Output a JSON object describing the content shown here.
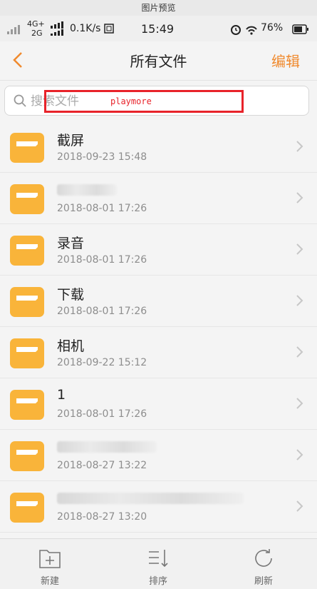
{
  "viewer_title": "图片预览",
  "status": {
    "network_top": "4G+",
    "network_bottom": "2G",
    "speed": "0.1K/s",
    "time": "15:49",
    "battery": "76%"
  },
  "nav": {
    "title": "所有文件",
    "edit": "编辑"
  },
  "search": {
    "placeholder": "搜索文件",
    "value": ""
  },
  "overlay_label": "playmore",
  "colors": {
    "accent": "#f08a2e",
    "folder": "#f9b43a",
    "overlay": "#e8232a"
  },
  "files": [
    {
      "name": "截屏",
      "date": "2018-09-23 15:48"
    },
    {
      "name": "",
      "date": "2018-08-01 17:26"
    },
    {
      "name": "录音",
      "date": "2018-08-01 17:26"
    },
    {
      "name": "下载",
      "date": "2018-08-01 17:26"
    },
    {
      "name": "相机",
      "date": "2018-09-22 15:12"
    },
    {
      "name": "1",
      "date": "2018-08-01 17:26"
    },
    {
      "name": "",
      "date": "2018-08-27 13:22"
    },
    {
      "name": "",
      "date": "2018-08-27 13:20"
    }
  ],
  "bottom": {
    "new": "新建",
    "sort": "排序",
    "refresh": "刷新"
  }
}
